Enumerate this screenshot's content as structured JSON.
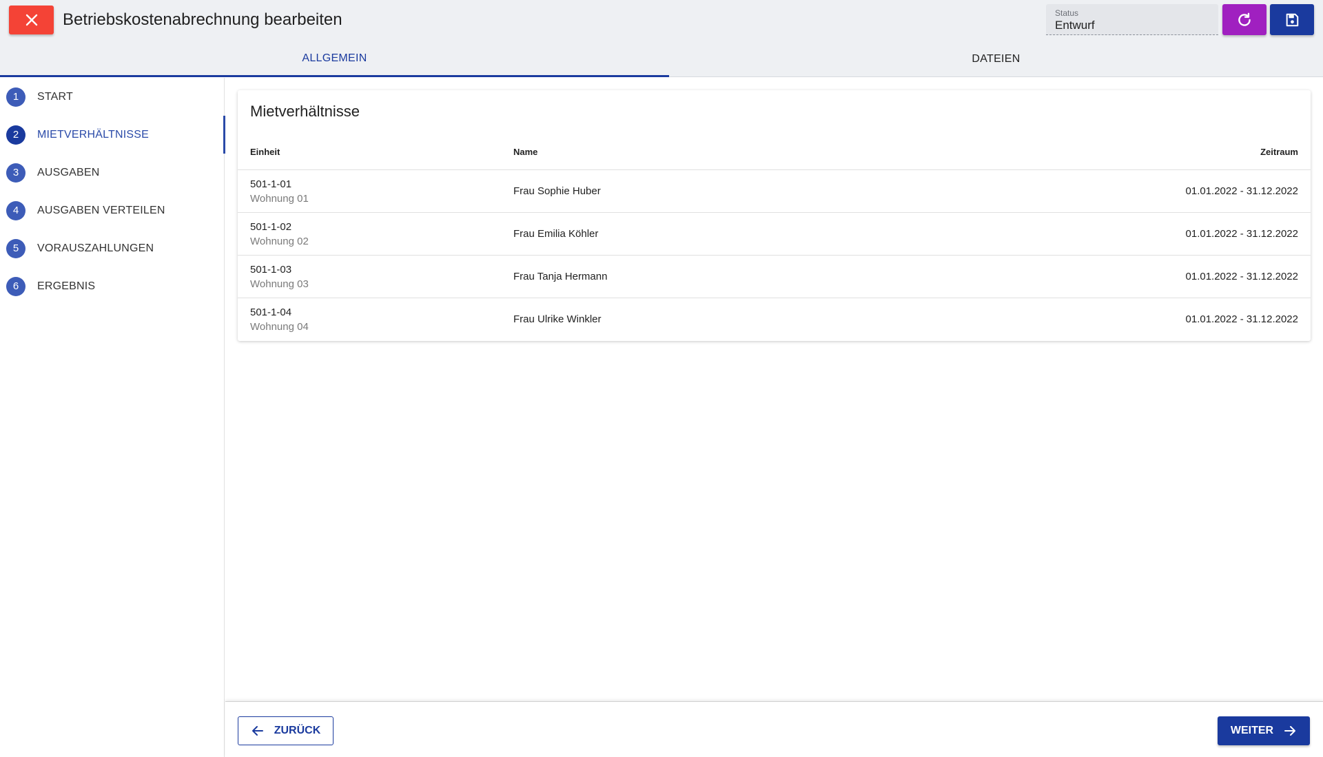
{
  "header": {
    "title": "Betriebskostenabrechnung bearbeiten",
    "status_label": "Status",
    "status_value": "Entwurf",
    "close_icon": "close-icon",
    "refresh_icon": "refresh-icon",
    "save_icon": "save-icon"
  },
  "tabs": [
    {
      "label": "ALLGEMEIN",
      "active": true
    },
    {
      "label": "DATEIEN",
      "active": false
    }
  ],
  "steps": [
    {
      "num": "1",
      "label": "START"
    },
    {
      "num": "2",
      "label": "MIETVERHÄLTNISSE",
      "active": true
    },
    {
      "num": "3",
      "label": "AUSGABEN"
    },
    {
      "num": "4",
      "label": "AUSGABEN VERTEILEN"
    },
    {
      "num": "5",
      "label": "VORAUSZAHLUNGEN"
    },
    {
      "num": "6",
      "label": "ERGEBNIS"
    }
  ],
  "card": {
    "title": "Mietverhältnisse",
    "columns": {
      "unit": "Einheit",
      "name": "Name",
      "period": "Zeitraum"
    },
    "rows": [
      {
        "unit": "501-1-01",
        "unit_sub": "Wohnung 01",
        "name": "Frau Sophie Huber",
        "period": "01.01.2022 - 31.12.2022"
      },
      {
        "unit": "501-1-02",
        "unit_sub": "Wohnung 02",
        "name": "Frau Emilia Köhler",
        "period": "01.01.2022 - 31.12.2022"
      },
      {
        "unit": "501-1-03",
        "unit_sub": "Wohnung 03",
        "name": "Frau Tanja Hermann",
        "period": "01.01.2022 - 31.12.2022"
      },
      {
        "unit": "501-1-04",
        "unit_sub": "Wohnung 04",
        "name": "Frau Ulrike Winkler",
        "period": "01.01.2022 - 31.12.2022"
      }
    ]
  },
  "footer": {
    "back_label": "ZURÜCK",
    "next_label": "WEITER"
  },
  "colors": {
    "primary": "#1a3a9e",
    "close": "#f44336",
    "refresh": "#a020c0",
    "step_circle": "#3d5cb8"
  }
}
